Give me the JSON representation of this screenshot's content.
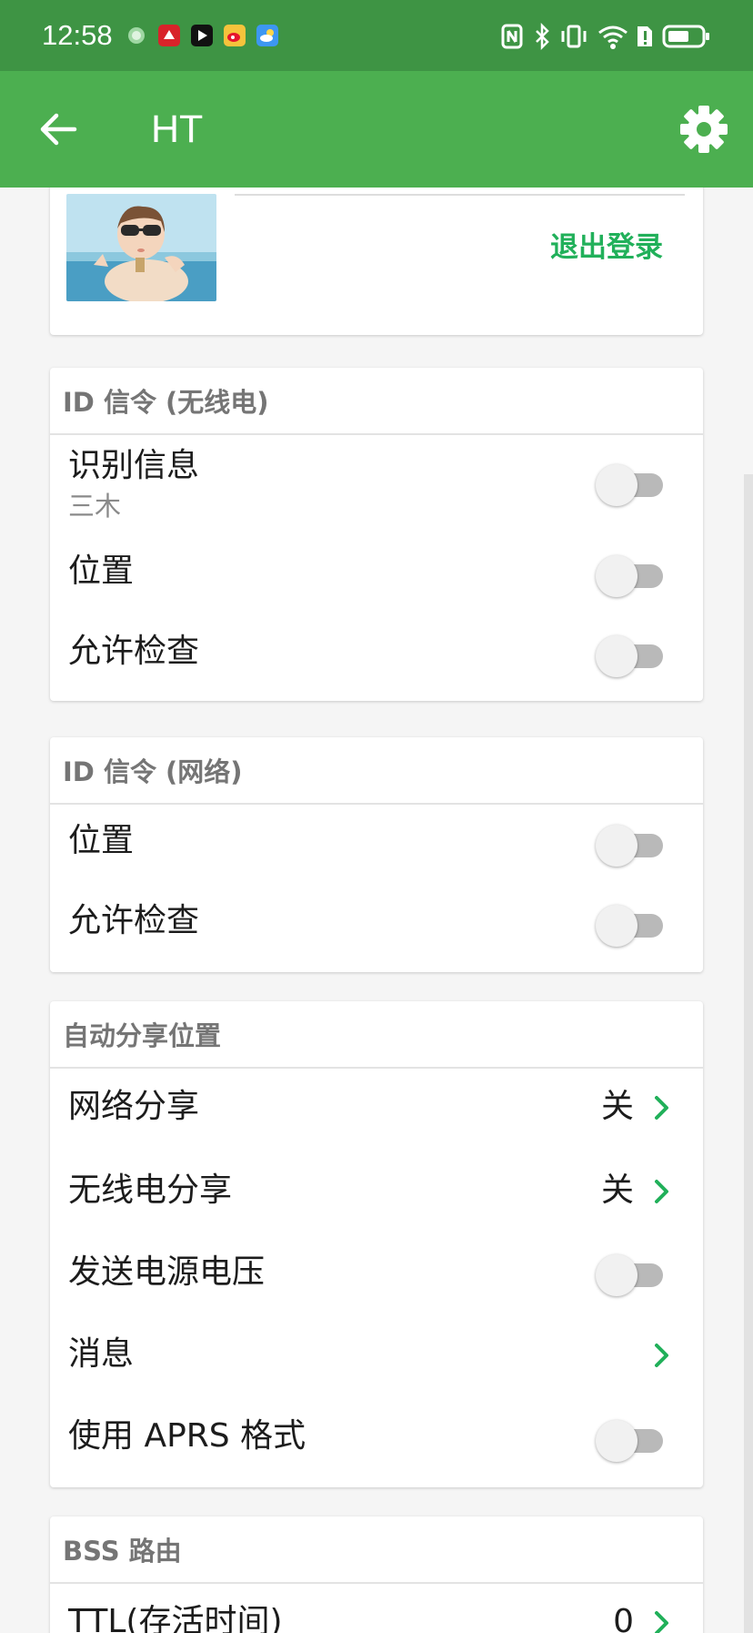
{
  "status_bar": {
    "time": "12:58",
    "app_icons": [
      "circle-notification-icon",
      "huawei-icon",
      "video-app-icon",
      "weibo-icon",
      "weather-icon"
    ],
    "right_icons": [
      "nfc-icon",
      "bluetooth-icon",
      "vibrate-icon",
      "wifi-icon",
      "sim-alert-icon",
      "battery-icon"
    ],
    "background_color": "#3e9444"
  },
  "app_bar": {
    "title": "HT",
    "back_icon": "arrow-left-icon",
    "settings_icon": "gear-icon",
    "background_color": "#4caf50"
  },
  "account": {
    "logout_label": "退出登录"
  },
  "sections": {
    "radio_id": {
      "header": "ID 信令 (无线电)",
      "items": [
        {
          "label": "识别信息",
          "sub": "三木",
          "toggle_on": false
        },
        {
          "label": "位置",
          "toggle_on": false
        },
        {
          "label": "允许检查",
          "toggle_on": false
        }
      ]
    },
    "network_id": {
      "header": "ID 信令 (网络)",
      "items": [
        {
          "label": "位置",
          "toggle_on": false
        },
        {
          "label": "允许检查",
          "toggle_on": false
        }
      ]
    },
    "auto_share": {
      "header": "自动分享位置",
      "items": [
        {
          "label": "网络分享",
          "value": "关"
        },
        {
          "label": "无线电分享",
          "value": "关"
        },
        {
          "label": "发送电源电压",
          "toggle_on": false
        },
        {
          "label": "消息"
        },
        {
          "label": "使用 APRS 格式",
          "toggle_on": false
        }
      ]
    },
    "bss": {
      "header": "BSS 路由",
      "items": [
        {
          "label": "TTL(存活时间)",
          "value": "0"
        }
      ]
    }
  },
  "colors": {
    "accent_green": "#21b05a",
    "toggle_track_off": "#b9b9b9",
    "toggle_thumb_off": "#f1f1f1"
  }
}
